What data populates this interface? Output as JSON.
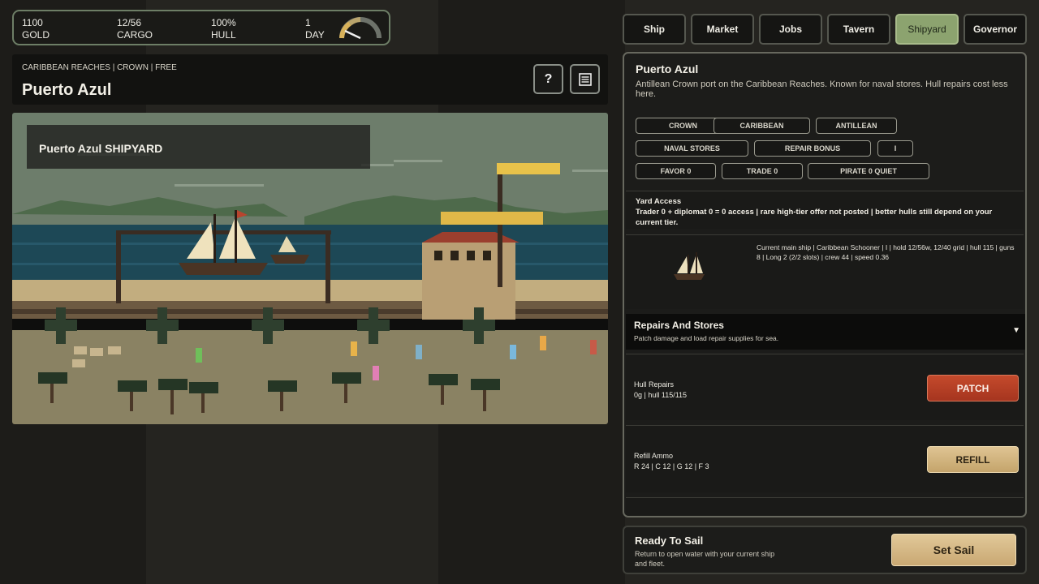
{
  "stats": {
    "gold": {
      "value": "1100",
      "label": "GOLD"
    },
    "cargo": {
      "value": "12/56",
      "label": "CARGO"
    },
    "hull": {
      "value": "100%",
      "label": "HULL"
    },
    "day": {
      "value": "1",
      "label": "DAY"
    },
    "gauge_icon": "speed-gauge-icon"
  },
  "port": {
    "region": "CARIBBEAN REACHES | CROWN | FREE",
    "name": "Puerto Azul",
    "help_label": "?",
    "menu_icon": "list-icon"
  },
  "scene": {
    "label": "Puerto Azul SHIPYARD",
    "colors": {
      "sky": "#6e7e6d",
      "sea": "#1e4a56",
      "sand": "#8c8464",
      "hills": "#4f6b4c"
    }
  },
  "tabs": [
    {
      "label": "Ship",
      "active": false
    },
    {
      "label": "Market",
      "active": false
    },
    {
      "label": "Jobs",
      "active": false
    },
    {
      "label": "Tavern",
      "active": false
    },
    {
      "label": "Shipyard",
      "active": true
    },
    {
      "label": "Governor",
      "active": false
    }
  ],
  "panel": {
    "title": "Puerto Azul",
    "description": "Antillean Crown port on the Caribbean Reaches. Known for naval stores. Hull repairs cost less here.",
    "chips": {
      "crown": "CROWN",
      "caribbean": "CARIBBEAN",
      "antillean": "ANTILLEAN",
      "naval_stores": "NAVAL STORES",
      "repair_bonus": "REPAIR BONUS",
      "i": "I",
      "favor": "FAVOR 0",
      "trade": "TRADE 0",
      "pirate": "PIRATE 0 QUIET"
    },
    "yard": {
      "title": "Yard Access",
      "text": "Trader 0 + diplomat 0 = 0 access | rare high-tier offer not posted | better hulls still depend on your current tier."
    },
    "ship": {
      "info": "Current main ship | Caribbean Schooner | I | hold 12/56w, 12/40 grid | hull 115 | guns 8 | Long 2 (2/2 slots) | crew 44 | speed 0.36"
    },
    "repairs": {
      "title": "Repairs And Stores",
      "subtitle": "Patch damage and load repair supplies for sea.",
      "caret": "▼"
    },
    "hull_row": {
      "label": "Hull Repairs",
      "detail": "0g | hull 115/115",
      "button": "PATCH"
    },
    "ammo_row": {
      "label": "Refill Ammo",
      "detail": "R 24 | C 12 | G 12 | F 3",
      "button": "REFILL"
    }
  },
  "sail": {
    "title": "Ready To Sail",
    "description": "Return to open water with your current ship and fleet.",
    "button": "Set Sail"
  }
}
